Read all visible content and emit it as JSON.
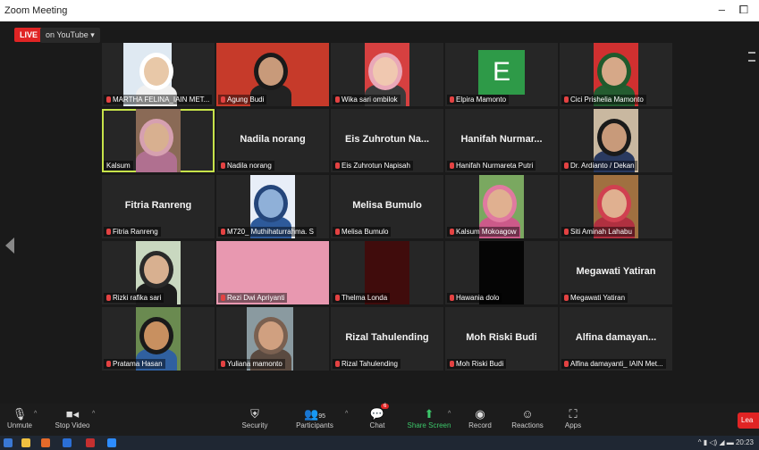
{
  "window": {
    "title": "Zoom Meeting",
    "minimize": "–",
    "maximize": "⧠"
  },
  "stream": {
    "live": "LIVE",
    "platform": "on YouTube ▾"
  },
  "participants": [
    {
      "name": "MARTHA FELINA_IAIN MET...",
      "display": "",
      "video": "woman-white-hijab"
    },
    {
      "name": "Agung Budi",
      "display": "",
      "video": "man-red-background"
    },
    {
      "name": "Wika sari ombilok",
      "display": "",
      "video": "woman-pink-hijab"
    },
    {
      "name": "Elpira Mamonto",
      "display": "",
      "video": "avatar-e"
    },
    {
      "name": "Cici Prishelia Mamonto",
      "display": "",
      "video": "woman-green"
    },
    {
      "name": "Kalsum",
      "display": "",
      "video": "woman-room"
    },
    {
      "name": "Nadila norang",
      "display": "Nadila norang",
      "video": ""
    },
    {
      "name": "Eis Zuhrotun Napisah",
      "display": "Eis Zuhrotun Na...",
      "video": ""
    },
    {
      "name": "Hanifah Nurmareta Putri",
      "display": "Hanifah Nurmar...",
      "video": ""
    },
    {
      "name": "Dr. Ardianto / Dekan",
      "display": "",
      "video": "man-portrait"
    },
    {
      "name": "Fitria Ranreng",
      "display": "Fitria Ranreng",
      "video": ""
    },
    {
      "name": "M720_ Muthihaturrahma. S",
      "display": "",
      "video": "blue-hand"
    },
    {
      "name": "Melisa Bumulo",
      "display": "Melisa Bumulo",
      "video": ""
    },
    {
      "name": "Kalsum Mokoagow",
      "display": "",
      "video": "woman-pink-outdoor"
    },
    {
      "name": "Siti Aminah Lahabu",
      "display": "",
      "video": "woman-red-outdoor"
    },
    {
      "name": "Rizki rafika sari",
      "display": "",
      "video": "woman-dark-hijab"
    },
    {
      "name": "Rezi Dwi Apriyanti",
      "display": "",
      "video": "pink-fabric"
    },
    {
      "name": "Thelma Londa",
      "display": "",
      "video": "dark-red"
    },
    {
      "name": "Hawania dolo",
      "display": "",
      "video": "dark"
    },
    {
      "name": "Megawati Yatiran",
      "display": "Megawati Yatiran",
      "video": ""
    },
    {
      "name": "Pratama Hasan",
      "display": "",
      "video": "boy-outdoor"
    },
    {
      "name": "Yuliana mamonto",
      "display": "",
      "video": "woman-close"
    },
    {
      "name": "Rizal Tahulending",
      "display": "Rizal Tahulending",
      "video": ""
    },
    {
      "name": "Moh Riski Budi",
      "display": "Moh Riski Budi",
      "video": ""
    },
    {
      "name": "Alfina damayanti_ IAIN Met...",
      "display": "Alfina damayan...",
      "video": ""
    }
  ],
  "toolbar": {
    "unmute": "Unmute",
    "stop_video": "Stop Video",
    "security": "Security",
    "participants": "Participants",
    "participant_count": "95",
    "chat": "Chat",
    "chat_badge": "6",
    "share_screen": "Share Screen",
    "record": "Record",
    "reactions": "Reactions",
    "apps": "Apps",
    "leave": "Lea"
  },
  "taskbar": {
    "time": "20:23"
  },
  "colors": {
    "active_speaker": "#c7e34a",
    "live_red": "#e02424",
    "share_green": "#3cc76a"
  }
}
